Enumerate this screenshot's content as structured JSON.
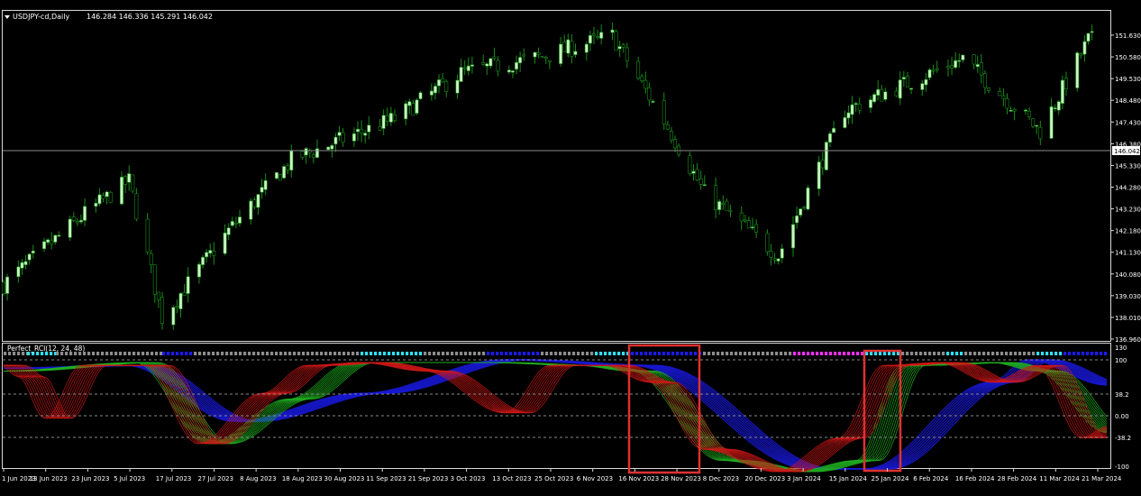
{
  "price_header": {
    "symbol": "USDJPY-cd,Daily",
    "ohlc": "146.284 146.336 145.291 146.042"
  },
  "current_price_label": "146.042",
  "price_axis_labels": [
    "151.630",
    "150.580",
    "149.530",
    "148.480",
    "147.430",
    "146.380",
    "145.330",
    "144.280",
    "143.230",
    "142.180",
    "141.130",
    "140.080",
    "139.030",
    "138.010",
    "136.960"
  ],
  "indicator": {
    "label": "Perfect_RCI(12, 24, 48)",
    "axis_labels": [
      "130",
      "100",
      "38.2",
      "0.00",
      "-38.2",
      "-100"
    ]
  },
  "date_labels": [
    "1 Jun 2023",
    "13 Jun 2023",
    "23 Jun 2023",
    "5 Jul 2023",
    "17 Jul 2023",
    "27 Jul 2023",
    "8 Aug 2023",
    "18 Aug 2023",
    "30 Aug 2023",
    "11 Sep 2023",
    "21 Sep 2023",
    "3 Oct 2023",
    "13 Oct 2023",
    "25 Oct 2023",
    "6 Nov 2023",
    "16 Nov 2023",
    "28 Nov 2023",
    "8 Dec 2023",
    "20 Dec 2023",
    "3 Jan 2024",
    "15 Jan 2024",
    "25 Jan 2024",
    "6 Feb 2024",
    "16 Feb 2024",
    "28 Feb 2024",
    "11 Mar 2024",
    "21 Mar 2024"
  ],
  "colors": {
    "background": "#000000",
    "candle": "#c8f5c0",
    "candle_edge": "#1a8c1a",
    "rci_short": "#d01818",
    "rci_mid": "#20b020",
    "rci_long": "#1818d0",
    "highlight_box": "#e03030",
    "dot_gray": "#8c8c8c",
    "dot_blue": "#1a1aff",
    "dot_cyan": "#30e0ff",
    "dot_magenta": "#ff30ff"
  },
  "chart_data": {
    "type": "candlestick",
    "symbol": "USDJPY-cd",
    "timeframe": "Daily",
    "current_price": 146.042,
    "price_range": [
      136.96,
      151.63
    ],
    "close_path_dates": [
      "2023-06-01",
      "2023-06-23",
      "2023-07-05",
      "2023-07-14",
      "2023-08-01",
      "2023-08-18",
      "2023-09-15",
      "2023-10-03",
      "2023-10-25",
      "2023-11-13",
      "2023-11-28",
      "2023-12-08",
      "2023-12-28",
      "2024-01-15",
      "2024-02-16",
      "2024-03-08",
      "2024-03-21"
    ],
    "close_path_values": [
      139.6,
      143.0,
      144.6,
      138.0,
      142.2,
      145.6,
      147.6,
      149.8,
      150.6,
      151.6,
      147.2,
      144.0,
      141.0,
      148.0,
      150.5,
      147.0,
      151.4
    ],
    "rci": {
      "periods": [
        12,
        24,
        48
      ],
      "levels": [
        100,
        38.2,
        0,
        -38.2,
        -100
      ],
      "range": [
        -100,
        130
      ]
    }
  }
}
